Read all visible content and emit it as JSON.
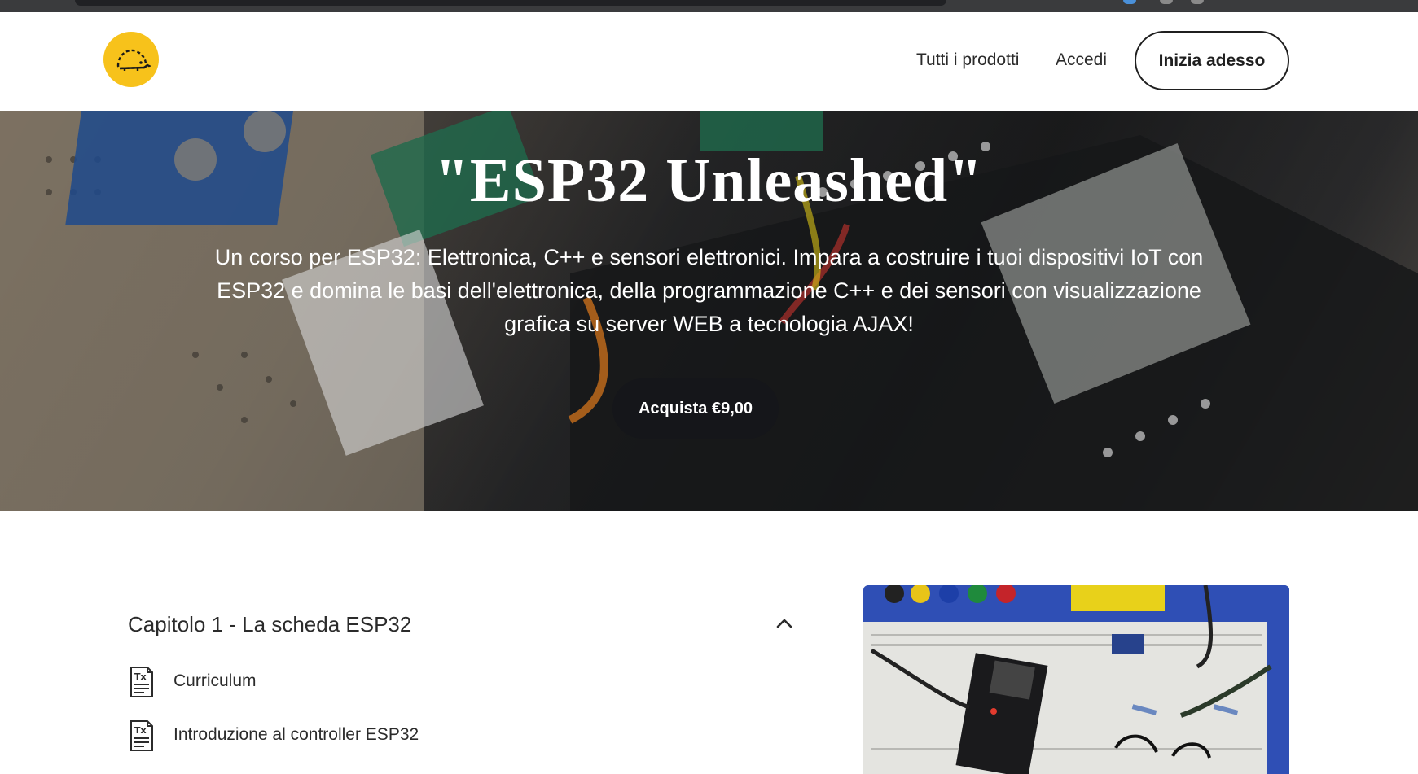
{
  "header": {
    "logo_icon": "hedgehog-logo-icon",
    "nav": {
      "all_products": "Tutti i prodotti",
      "login": "Accedi",
      "cta": "Inizia adesso"
    }
  },
  "hero": {
    "title": "\"ESP32 Unleashed\"",
    "description": "Un corso per ESP32: Elettronica, C++ e sensori elettronici. Impara a costruire i tuoi dispositivi IoT con ESP32 e domina le basi dell'elettronica, della programmazione C++ e dei sensori con visualizzazione grafica su server WEB a tecnologia AJAX!",
    "buy_label": "Acquista €9,00"
  },
  "curriculum": {
    "chapter_title": "Capitolo 1 - La scheda ESP32",
    "chapter_icon": "chevron-up-icon",
    "lessons": [
      {
        "label": "Curriculum",
        "icon": "text-document-icon"
      },
      {
        "label": "Introduzione al controller ESP32",
        "icon": "text-document-icon"
      }
    ]
  },
  "colors": {
    "logo_yellow": "#f7c21b",
    "button_dark": "#15161a",
    "text_dark": "#2b2b2b"
  }
}
